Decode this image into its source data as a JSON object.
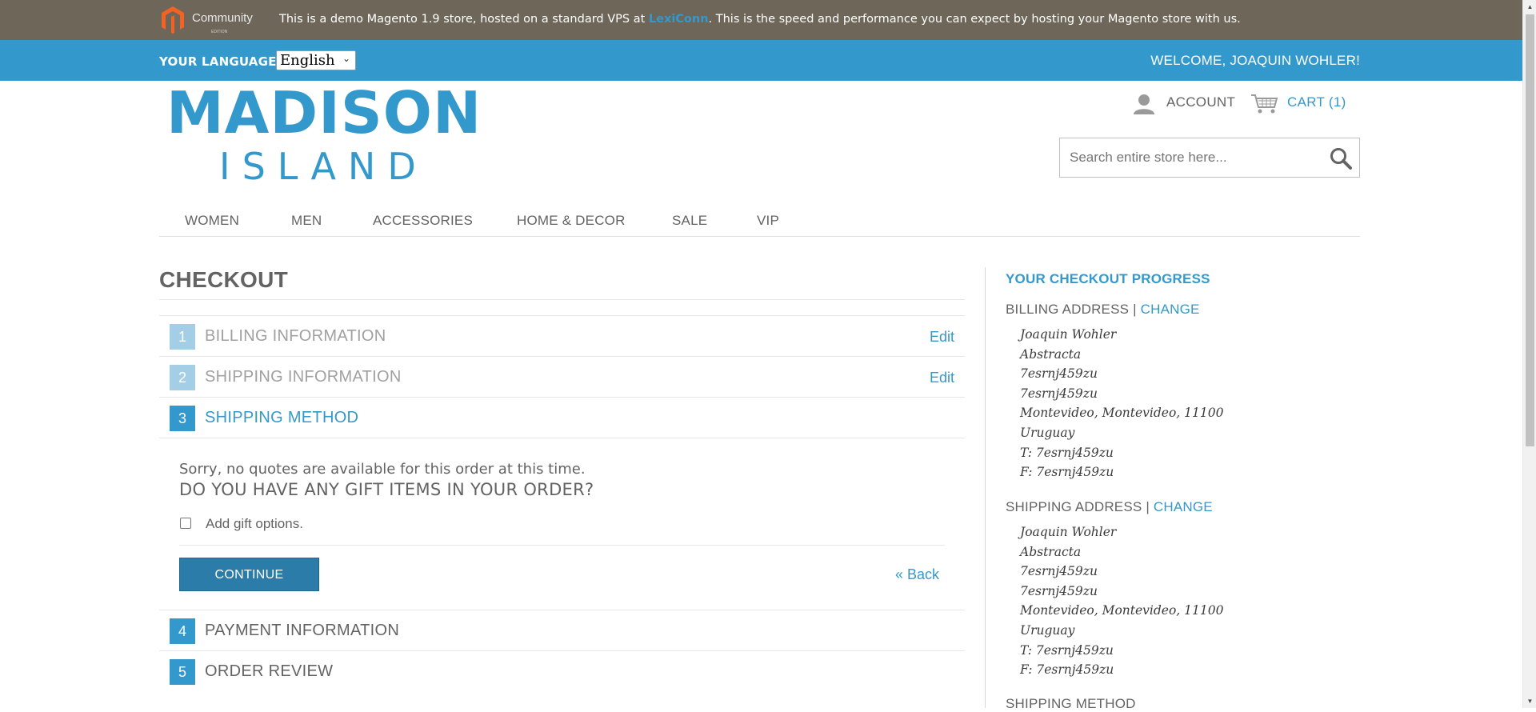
{
  "demo_bar": {
    "logo_text": "Community",
    "logo_subtext": "EDITION",
    "text_before": "This is a demo Magento 1.9 store, hosted on a standard VPS at ",
    "link": "LexiConn",
    "text_after": ". This is the speed and performance you can expect by hosting your Magento store with us."
  },
  "header": {
    "language_label": "YOUR LANGUAGE:",
    "language_value": "English",
    "welcome": "WELCOME, JOAQUIN WOHLER!"
  },
  "logo": {
    "line1": "MADISON",
    "line2": "ISLAND"
  },
  "account": {
    "label": "ACCOUNT"
  },
  "cart": {
    "label": "CART (1)"
  },
  "search": {
    "placeholder": "Search entire store here..."
  },
  "nav": [
    "WOMEN",
    "MEN",
    "ACCESSORIES",
    "HOME & DECOR",
    "SALE",
    "VIP"
  ],
  "checkout": {
    "title": "CHECKOUT",
    "steps": [
      {
        "num": "1",
        "title": "BILLING INFORMATION",
        "edit": "Edit"
      },
      {
        "num": "2",
        "title": "SHIPPING INFORMATION",
        "edit": "Edit"
      },
      {
        "num": "3",
        "title": "SHIPPING METHOD"
      },
      {
        "num": "4",
        "title": "PAYMENT INFORMATION"
      },
      {
        "num": "5",
        "title": "ORDER REVIEW"
      }
    ],
    "shipping_method": {
      "sorry": "Sorry, no quotes are available for this order at this time.",
      "gift_question": "DO YOU HAVE ANY GIFT ITEMS IN YOUR ORDER?",
      "gift_label": "Add gift options.",
      "continue": "CONTINUE",
      "back": "« Back"
    }
  },
  "progress": {
    "title": "YOUR CHECKOUT PROGRESS",
    "billing_head": "BILLING ADDRESS",
    "shipping_head": "SHIPPING ADDRESS",
    "separator": " | ",
    "change": "CHANGE",
    "billing_lines": [
      "Joaquin Wohler",
      "Abstracta",
      "7esrnj459zu",
      "7esrnj459zu",
      "Montevideo, Montevideo, 11100",
      "Uruguay",
      "T: 7esrnj459zu",
      "F: 7esrnj459zu"
    ],
    "shipping_lines": [
      "Joaquin Wohler",
      "Abstracta",
      "7esrnj459zu",
      "7esrnj459zu",
      "Montevideo, Montevideo, 11100",
      "Uruguay",
      "T: 7esrnj459zu",
      "F: 7esrnj459zu"
    ],
    "shipping_method_head": "SHIPPING METHOD"
  },
  "colors": {
    "brand": "#3399cc",
    "demo_bar": "#6e6659",
    "text": "#636363",
    "button": "#2b7ca8"
  }
}
